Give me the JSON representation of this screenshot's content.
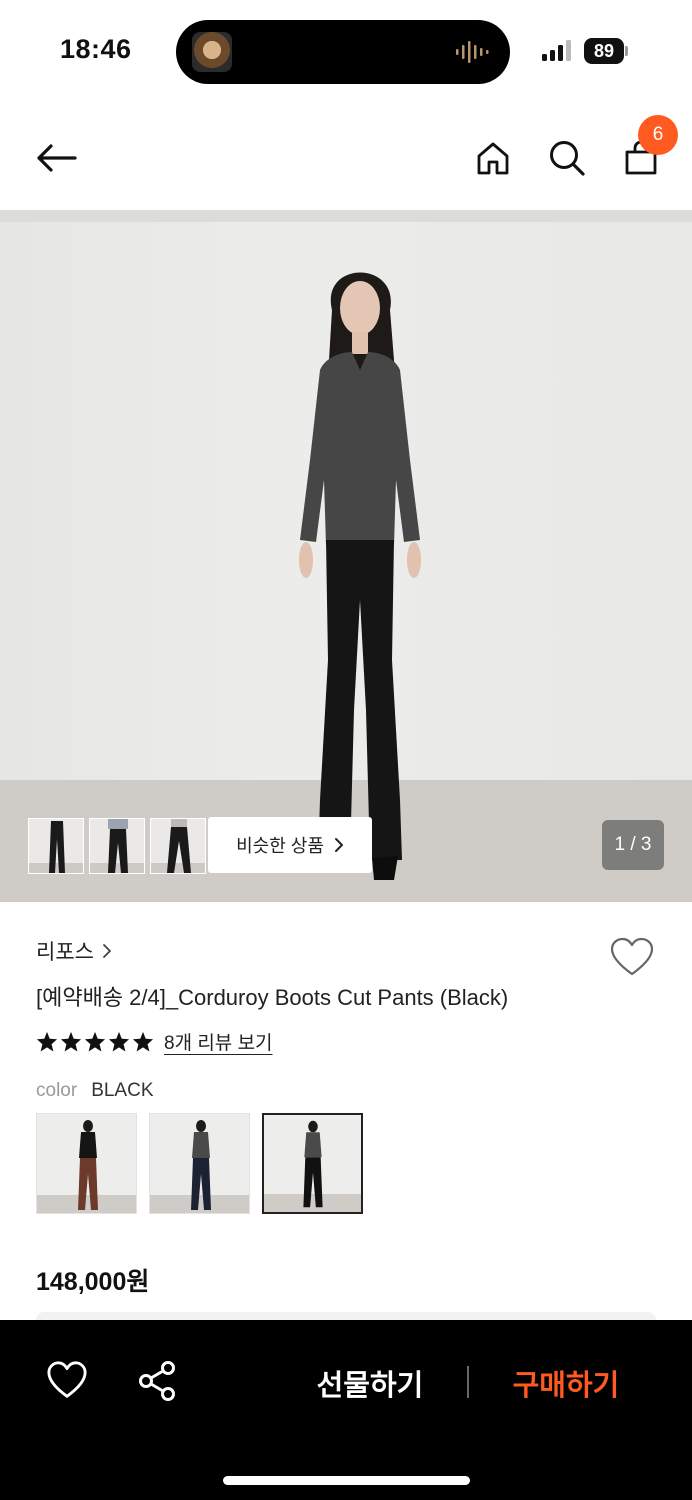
{
  "status_bar": {
    "time": "18:46",
    "battery": "89"
  },
  "header": {
    "back_icon": "arrow-left-icon",
    "home_icon": "home-icon",
    "search_icon": "search-icon",
    "cart_icon": "shopping-bag-icon",
    "cart_count": "6"
  },
  "gallery": {
    "similar_label": "비슷한 상품",
    "page_counter": "1 / 3",
    "thumbnail_count": 3
  },
  "product": {
    "brand": "리포스",
    "title": "[예약배송 2/4]_Corduroy Boots Cut Pants (Black)",
    "rating_stars": 5,
    "review_link": "8개 리뷰 보기",
    "color_label": "color",
    "color_value": "BLACK",
    "price": "148,000원"
  },
  "bottom_bar": {
    "gift_label": "선물하기",
    "buy_label": "구매하기"
  },
  "colors": {
    "accent": "#ff5a1f",
    "bar_bg": "#000000"
  }
}
